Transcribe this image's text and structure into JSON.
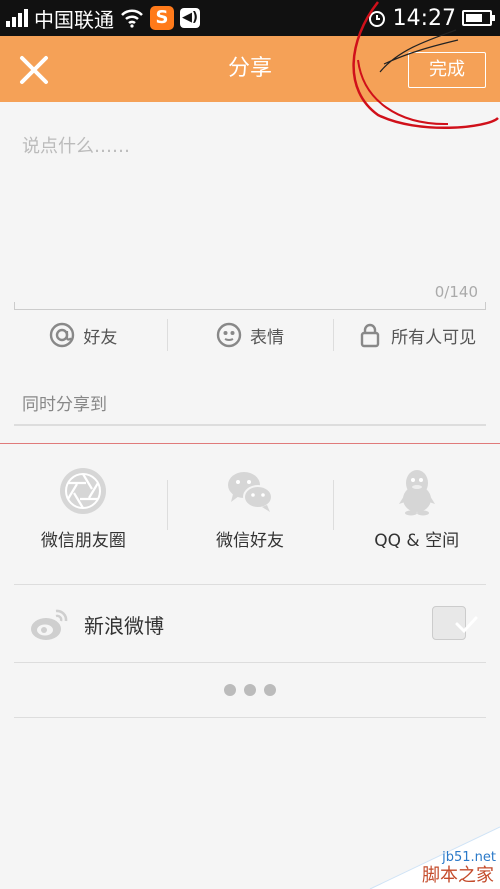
{
  "status_bar": {
    "carrier": "中国联通",
    "sogou": "S",
    "volume": "◀)",
    "time": "14:27"
  },
  "header": {
    "title": "分享",
    "done_label": "完成"
  },
  "compose": {
    "placeholder": "说点什么……",
    "counter": "0/140"
  },
  "toolbar": {
    "friends": "好友",
    "emoji": "表情",
    "visibility": "所有人可见"
  },
  "share_to": {
    "label": "同时分享到",
    "apps": [
      {
        "label": "微信朋友圈",
        "icon": "camera-aperture-icon"
      },
      {
        "label": "微信好友",
        "icon": "wechat-icon"
      },
      {
        "label": "QQ & 空间",
        "icon": "qq-penguin-icon"
      }
    ],
    "weibo_label": "新浪微博",
    "weibo_checked": true
  },
  "watermark": {
    "domain": "jb51.net",
    "site": "脚本之家"
  },
  "colors": {
    "header": "#f5a157",
    "annotation": "#d0101a"
  }
}
